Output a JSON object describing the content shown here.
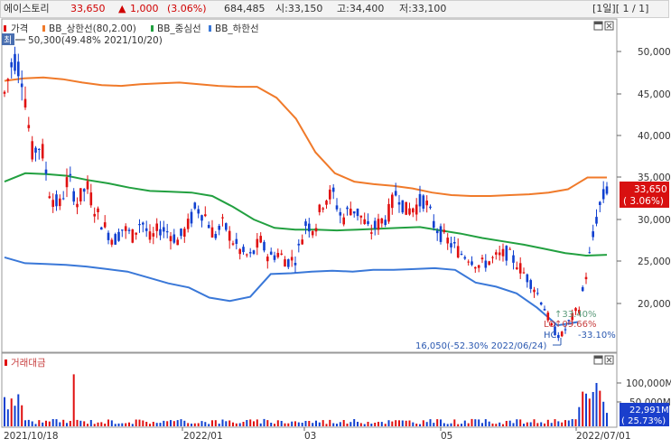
{
  "header": {
    "name": "에이스토리",
    "price": "33,650",
    "change_arrow": "▲",
    "change": "1,000",
    "change_pct": "(3.06%)",
    "volume": "684,485",
    "open": "시:33,150",
    "high": "고:34,400",
    "low": "저:33,100",
    "period": "[1일][ 1 / 1]"
  },
  "legend": {
    "price": "가격",
    "upper": "BB_상한선(80,2.00)",
    "middle": "BB_중심선",
    "lower": "BB_하한선",
    "peak_badge": "최",
    "peak_text": "50,300(49.48% 2021/10/20)"
  },
  "annotations": {
    "low_text": "16,050(-52.30% 2022/06/24)",
    "ratio_hi": "↑33.40%",
    "ratio_mid": "↑09.66%",
    "ratio_lo": "-33.10%",
    "tag_lo": "LO",
    "tag_hc": "HC"
  },
  "price_axis": {
    "ticks": [
      "50,000",
      "45,000",
      "40,000",
      "35,000",
      "30,000",
      "25,000",
      "20,000"
    ],
    "last_price": "33,650",
    "last_pct": "( 3.06%)"
  },
  "volume_panel": {
    "label": "거래대금",
    "ticks": [
      "100,000M",
      "50,000M"
    ],
    "last_value": "22,991M",
    "last_pct": "( 25.73%)"
  },
  "x_labels": [
    "2021/10/18",
    "2022/01",
    "03",
    "05",
    "2022/07/01"
  ],
  "colors": {
    "up": "#e01010",
    "down": "#1040d0",
    "upper": "#f07a2a",
    "middle": "#22a040",
    "lower": "#3a78d8"
  },
  "chart_data": {
    "type": "line",
    "title": "에이스토리",
    "x_range": [
      "2021/10/18",
      "2022/07/01"
    ],
    "ylim": [
      16000,
      50500
    ],
    "series": [
      {
        "name": "가격",
        "values": [
          45000,
          49500,
          47000,
          38000,
          39000,
          33000,
          31500,
          35000,
          32000,
          34000,
          31000,
          29000,
          27500,
          29000,
          28000,
          30000,
          27500,
          29000,
          28500,
          27500,
          29000,
          31500,
          30500,
          28000,
          29500,
          27500,
          26000,
          25500,
          27500,
          25500,
          26000,
          25000,
          25500,
          29500,
          29000,
          32500,
          33000,
          30000,
          31500,
          30500,
          28500,
          29500,
          30500,
          33500,
          31000,
          31500,
          32500,
          29500,
          28000,
          27000,
          26000,
          25500,
          24500,
          25000,
          25500,
          26000,
          25000,
          23500,
          22000,
          20000,
          17000,
          16050,
          18000,
          19500,
          25000,
          31000,
          33650
        ]
      },
      {
        "name": "BB_상한선(80,2.00)",
        "values": [
          46500,
          46800,
          46900,
          46700,
          46300,
          46000,
          45900,
          46100,
          46200,
          46300,
          46100,
          45900,
          45800,
          45800,
          44500,
          42000,
          38000,
          35500,
          34500,
          34200,
          34000,
          33700,
          33200,
          32900,
          32800,
          32800,
          32900,
          33000,
          33200,
          33600,
          35000,
          35000
        ]
      },
      {
        "name": "BB_중심선",
        "values": [
          34500,
          35500,
          35400,
          35200,
          34700,
          34300,
          33800,
          33400,
          33300,
          33200,
          32800,
          31500,
          30000,
          29000,
          28800,
          28800,
          28700,
          28800,
          28900,
          29000,
          29100,
          28700,
          28300,
          27800,
          27400,
          27000,
          26500,
          26000,
          25700,
          25800
        ]
      },
      {
        "name": "BB_하한선",
        "values": [
          25500,
          24800,
          24700,
          24600,
          24400,
          24100,
          23800,
          23100,
          22400,
          21900,
          20700,
          20300,
          20800,
          23500,
          23600,
          23800,
          23900,
          23800,
          24000,
          24000,
          24100,
          24200,
          24000,
          22500,
          22000,
          21200,
          19500,
          17400,
          17800
        ]
      }
    ],
    "volume": {
      "name": "거래대금",
      "ylim": [
        0,
        130000
      ]
    }
  }
}
